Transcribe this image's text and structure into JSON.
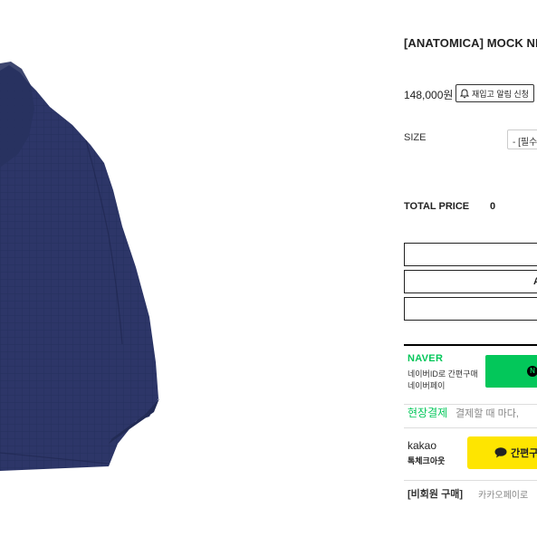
{
  "product": {
    "title": "[ANATOMICA] MOCK NE",
    "price": "148,000원",
    "restock_label": "재입고 알림 신청"
  },
  "option": {
    "size_label": "SIZE",
    "size_select_value": "- [필수"
  },
  "total": {
    "label": "TOTAL PRICE",
    "value": "0"
  },
  "buttons": {
    "box2_text": "A"
  },
  "naver": {
    "logo": "NAVER",
    "desc_line1": "네이버ID로 간편구매",
    "desc_line2": "네이버페이",
    "pay_badge": "N"
  },
  "onsite": {
    "label": "현장결제",
    "text": "결제할 때 마다,"
  },
  "kakao": {
    "logo": "kakao",
    "sub": "톡체크아웃",
    "button_label": "간편구"
  },
  "guest": {
    "label": "[비회원 구매]",
    "text": "카카오페이로"
  },
  "colors": {
    "naver_green": "#03c75a",
    "kakao_yellow": "#fee500",
    "garment_navy": "#2b3566"
  }
}
